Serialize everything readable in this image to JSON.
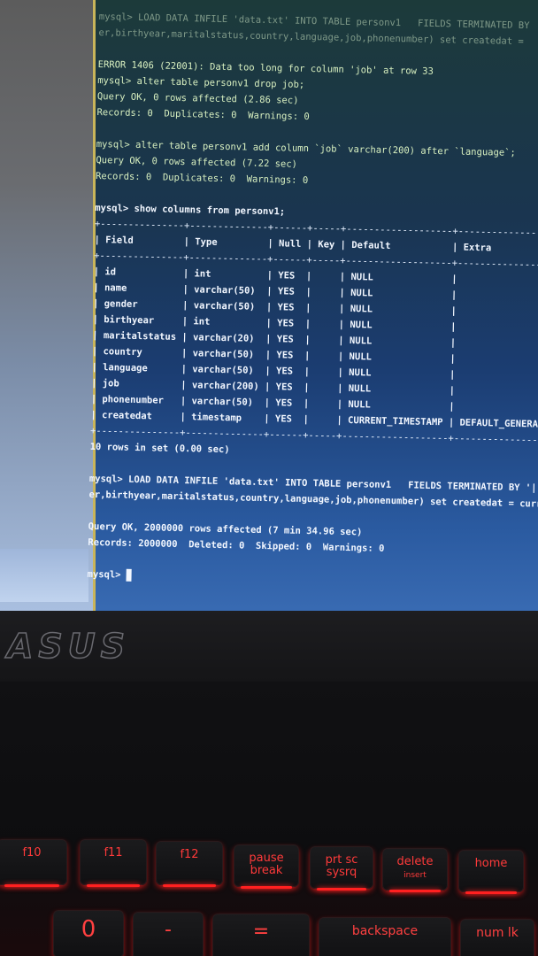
{
  "terminal": {
    "lines_top": [
      "mysql> LOAD DATA INFILE 'data.txt' INTO TABLE personv1   FIELDS TERMINATED BY",
      "er,birthyear,maritalstatus,country,language,job,phonenumber) set createdat ="
    ],
    "error_block": [
      "ERROR 1406 (22001): Data too long for column 'job' at row 33",
      "mysql> alter table personv1 drop job;",
      "Query OK, 0 rows affected (2.86 sec)",
      "Records: 0  Duplicates: 0  Warnings: 0"
    ],
    "alter_block": [
      "mysql> alter table personv1 add column `job` varchar(200) after `language`;",
      "Query OK, 0 rows affected (7.22 sec)",
      "Records: 0  Duplicates: 0  Warnings: 0"
    ],
    "show_cmd": "mysql> show columns from personv1;",
    "table_border": "+---------------+--------------+------+-----+-------------------+-------------------",
    "table_header": "| Field         | Type         | Null | Key | Default           | Extra",
    "table_rows": [
      "| id            | int          | YES  |     | NULL              |",
      "| name          | varchar(50)  | YES  |     | NULL              |",
      "| gender        | varchar(50)  | YES  |     | NULL              |",
      "| birthyear     | int          | YES  |     | NULL              |",
      "| maritalstatus | varchar(20)  | YES  |     | NULL              |",
      "| country       | varchar(50)  | YES  |     | NULL              |",
      "| language      | varchar(50)  | YES  |     | NULL              |",
      "| job           | varchar(200) | YES  |     | NULL              |",
      "| phonenumber   | varchar(50)  | YES  |     | NULL              |",
      "| createdat     | timestamp    | YES  |     | CURRENT_TIMESTAMP | DEFAULT_GENERA"
    ],
    "rows_in_set": "10 rows in set (0.00 sec)",
    "load_cmd": [
      "mysql> LOAD DATA INFILE 'data.txt' INTO TABLE personv1   FIELDS TERMINATED BY '|'",
      "er,birthyear,maritalstatus,country,language,job,phonenumber) set createdat = curr"
    ],
    "load_result": [
      "Query OK, 2000000 rows affected (7 min 34.96 sec)",
      "Records: 2000000  Deleted: 0  Skipped: 0  Warnings: 0"
    ],
    "prompt": "mysql> "
  },
  "laptop": {
    "brand": "ASUS"
  },
  "keys": [
    {
      "label": "f10",
      "sub": ""
    },
    {
      "label": "f11",
      "sub": ""
    },
    {
      "label": "f12",
      "sub": ""
    },
    {
      "label": "pause",
      "sub": "break"
    },
    {
      "label": "prt sc",
      "sub": "sysrq"
    },
    {
      "label": "delete",
      "sub": "insert"
    },
    {
      "label": "home",
      "sub": ""
    }
  ],
  "keys_lower": [
    "0",
    "-",
    "=",
    "backspace",
    "num lk"
  ],
  "colors": {
    "terminal_text": "#d8f0c0",
    "key_glow": "#ff2020",
    "screen_bg": "#1b3d72"
  }
}
